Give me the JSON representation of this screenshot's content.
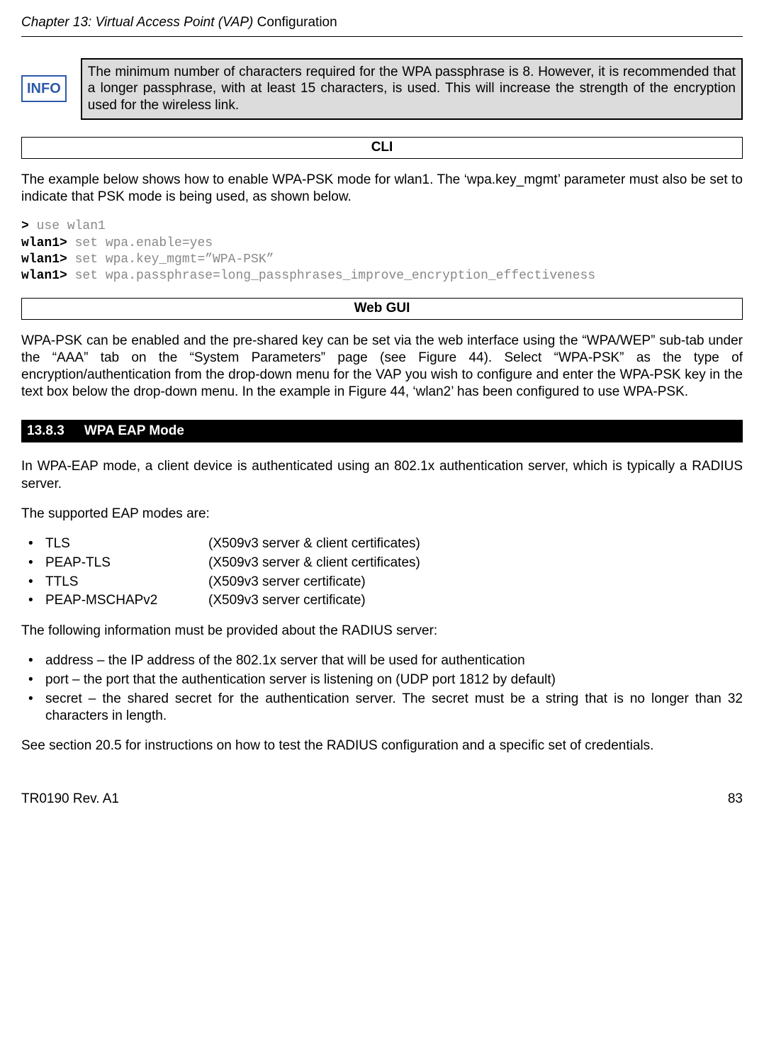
{
  "header": {
    "chapter_prefix": "Chapter 13: Virtual Access Point (VAP) ",
    "chapter_suffix": "Configuration"
  },
  "info": {
    "badge": "INFO",
    "text": "The minimum number of characters required for the WPA passphrase is 8. However, it is recommended that a longer passphrase, with at least 15 characters, is used. This will increase the strength of the encryption used for the wireless link."
  },
  "cli": {
    "label": "CLI",
    "intro": "The example below shows how to enable WPA-PSK mode for wlan1. The ‘wpa.key_mgmt’ parameter must also be set to indicate that PSK mode is being used, as shown below.",
    "lines": {
      "l1_prompt": ">",
      "l1_cmd": " use wlan1",
      "l2_prompt": "wlan1>",
      "l2_cmd": " set wpa.enable=yes",
      "l3_prompt": "wlan1>",
      "l3_cmd": " set wpa.key_mgmt=”WPA-PSK”",
      "l4_prompt": "wlan1>",
      "l4_cmd": " set wpa.passphrase=long_passphrases_improve_encryption_effectiveness"
    }
  },
  "webgui": {
    "label": "Web GUI",
    "text": "WPA-PSK can be enabled and the pre-shared key can be set via the web interface using the “WPA/WEP” sub-tab under the “AAA” tab on the “System Parameters” page (see Figure 44). Select “WPA-PSK” as the type of encryption/authentication from the drop-down menu for the VAP you wish to configure and enter the WPA-PSK key in the text box below the drop-down menu. In the example in Figure 44, ‘wlan2’ has been configured to use WPA-PSK."
  },
  "section": {
    "number": "13.8.3",
    "title": "WPA EAP Mode",
    "intro": "In WPA-EAP mode, a client device is authenticated using an 802.1x authentication server, which is typically a RADIUS server.",
    "supported_label": "The supported EAP modes are:",
    "eap_modes": [
      {
        "name": "TLS",
        "desc": "(X509v3 server & client certificates)"
      },
      {
        "name": "PEAP-TLS",
        "desc": "(X509v3 server & client certificates)"
      },
      {
        "name": "TTLS",
        "desc": "(X509v3 server certificate)"
      },
      {
        "name": "PEAP-MSCHAPv2",
        "desc": "(X509v3 server certificate)"
      }
    ],
    "radius_label": "The following information must be provided about the RADIUS server:",
    "radius_items": [
      "address – the IP address of the 802.1x server that will be used for authentication",
      "port – the port that the authentication server is listening on (UDP port 1812 by default)",
      "secret – the shared secret for the authentication server. The secret must be a string that is no longer than 32 characters in length."
    ],
    "closing": "See section 20.5 for instructions on how to test the RADIUS configuration and a specific set of credentials."
  },
  "footer": {
    "left": "TR0190 Rev. A1",
    "right": "83"
  },
  "bullet_char": "•"
}
